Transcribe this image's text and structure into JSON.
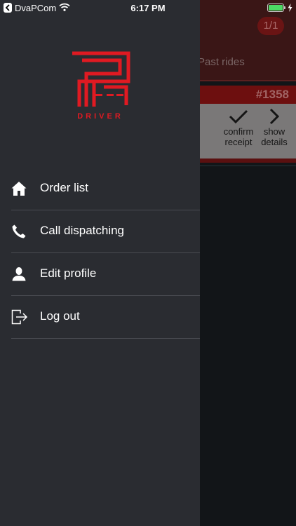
{
  "status_bar": {
    "back_app": "DvaPCom",
    "time": "6:17 PM",
    "wifi_icon": "wifi-icon",
    "battery_icon": "battery-icon",
    "battery_level": 1.0,
    "charging_icon": "charging-bolt-icon"
  },
  "background": {
    "page_counter": "1/1",
    "tab_past_rides": "Past rides",
    "order_id": "#1358",
    "confirm_label_1": "confirm",
    "confirm_label_2": "receipt",
    "details_label_1": "show",
    "details_label_2": "details"
  },
  "drawer": {
    "logo_caption": "DRIVER",
    "brand_color": "#e01a22",
    "menu": [
      {
        "label": "Order list",
        "icon": "home-icon"
      },
      {
        "label": "Call dispatching",
        "icon": "phone-icon"
      },
      {
        "label": "Edit profile",
        "icon": "user-icon"
      },
      {
        "label": "Log out",
        "icon": "logout-icon"
      }
    ]
  }
}
